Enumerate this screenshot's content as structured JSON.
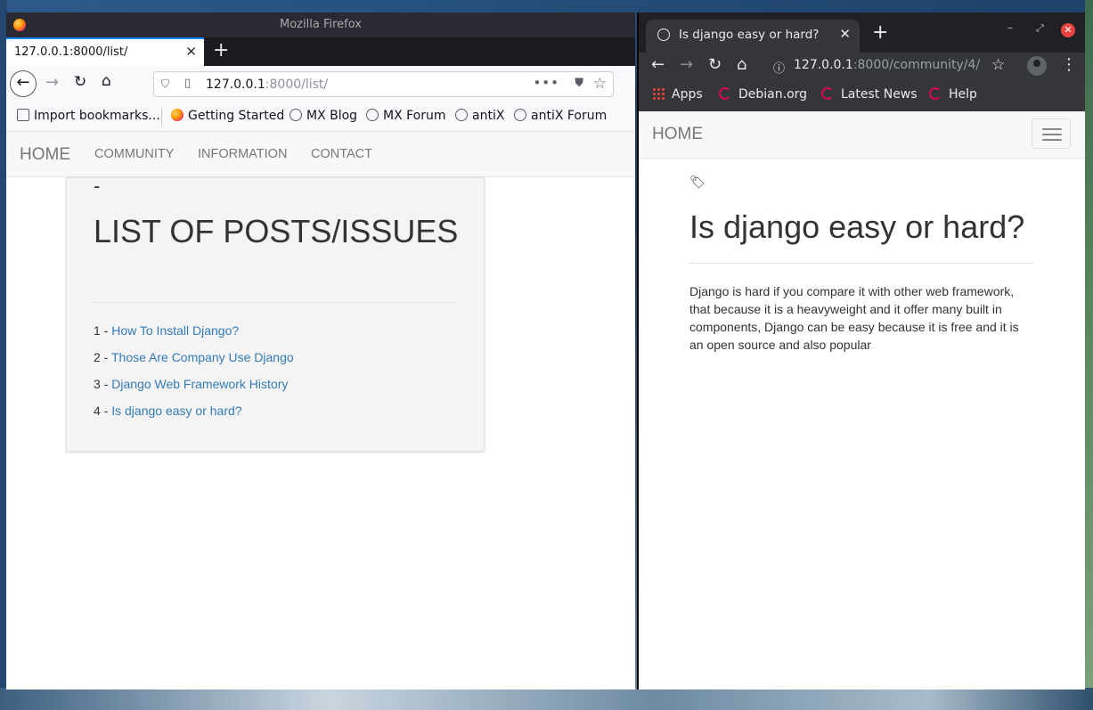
{
  "firefox": {
    "window_title": "Mozilla Firefox",
    "tab_title": "127.0.0.1:8000/list/",
    "url_host": "127.0.0.1",
    "url_rest": ":8000/list/",
    "bookmarks": [
      "Import bookmarks...",
      "Getting Started",
      "MX Blog",
      "MX Forum",
      "antiX",
      "antiX Forum"
    ],
    "site": {
      "brand": "HOME",
      "nav": [
        "COMMUNITY",
        "INFORMATION",
        "CONTACT"
      ],
      "dash": "-",
      "heading": "LIST OF POSTS/ISSUES",
      "posts": [
        {
          "num": "1 - ",
          "title": "How To Install Django?"
        },
        {
          "num": "2 - ",
          "title": "Those Are Company Use Django"
        },
        {
          "num": "3 - ",
          "title": "Django Web Framework History"
        },
        {
          "num": "4 - ",
          "title": "Is django easy or hard?"
        }
      ]
    }
  },
  "chrome": {
    "tab_title": "Is django easy or hard?",
    "url_host": "127.0.0.1",
    "url_rest": ":8000/community/4/",
    "bookmarks": [
      "Apps",
      "Debian.org",
      "Latest News",
      "Help"
    ],
    "site": {
      "brand": "HOME",
      "post_title": "Is django easy or hard?",
      "post_body": "Django is hard if you compare it with other web framework, that because it is a heavyweight and it offer many built in components, Django can be easy because it is free and it is an open source and also popular"
    }
  },
  "colors": {
    "link": "#337ab7",
    "firefox_accent": "#0a84ff",
    "chrome_dark": "#35363a"
  }
}
